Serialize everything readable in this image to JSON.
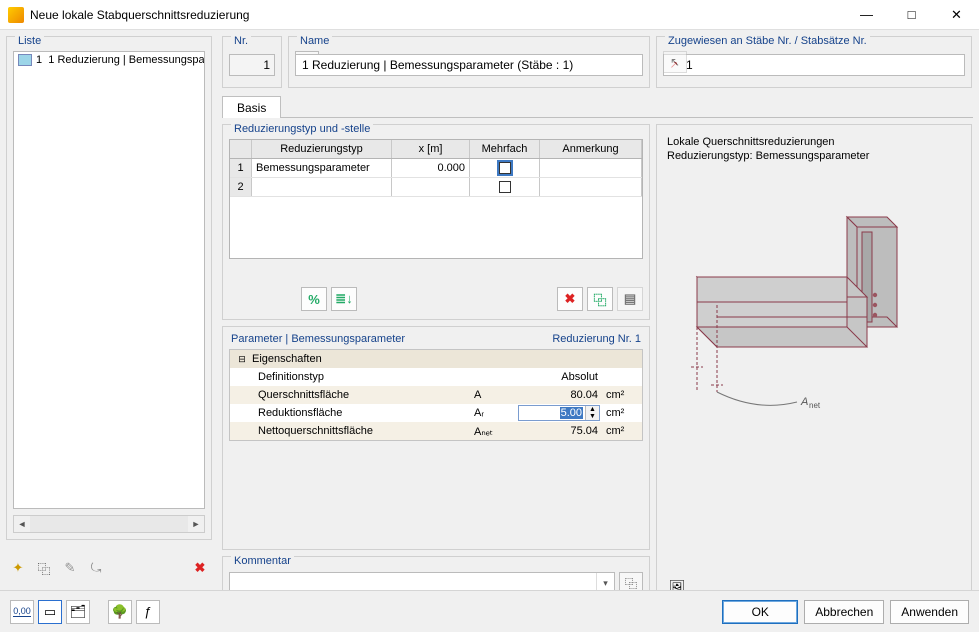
{
  "window": {
    "title": "Neue lokale Stabquerschnittsreduzierung"
  },
  "panels": {
    "liste": "Liste",
    "nr": "Nr.",
    "name": "Name",
    "assigned": "Zugewiesen an Stäbe Nr. / Stabsätze Nr.",
    "basis_tab": "Basis",
    "redtyp": "Reduzierungstyp und -stelle",
    "param": "Parameter | Bemessungsparameter",
    "rednr": "Reduzierung Nr. 1",
    "kommentar": "Kommentar"
  },
  "list": {
    "items": [
      {
        "id": "1",
        "num": "1",
        "label": "Reduzierung | Bemessungspa"
      }
    ]
  },
  "header": {
    "nr_value": "1",
    "name_value": "1 Reduzierung | Bemessungsparameter (Stäbe : 1)",
    "assigned_value": "1"
  },
  "grid": {
    "cols": {
      "typ": "Reduzierungstyp",
      "x": "x [m]",
      "mf": "Mehrfach",
      "an": "Anmerkung"
    },
    "rows": [
      {
        "n": "1",
        "typ": "Bemessungsparameter",
        "x": "0.000",
        "mf": false,
        "an": ""
      },
      {
        "n": "2",
        "typ": "",
        "x": "",
        "mf": null,
        "an": ""
      }
    ],
    "tb": {
      "pct": "%",
      "sort": "≣↓",
      "del": "✖",
      "copy": "⿻",
      "more": "▤"
    }
  },
  "param": {
    "cat": "Eigenschaften",
    "rows": [
      {
        "name": "Definitionstyp",
        "sym": "",
        "val": "Absolut",
        "unit": ""
      },
      {
        "name": "Querschnittsfläche",
        "sym": "A",
        "val": "80.04",
        "unit": "cm²"
      },
      {
        "name": "Reduktionsfläche",
        "sym": "Aᵣ",
        "val": "5.00",
        "unit": "cm²",
        "edit": true
      },
      {
        "name": "Nettoquerschnittsfläche",
        "sym": "Aₙₑₜ",
        "val": "75.04",
        "unit": "cm²"
      }
    ]
  },
  "preview": {
    "line1": "Lokale Querschnittsreduzierungen",
    "line2": "Reduzierungstyp: Bemessungsparameter"
  },
  "buttons": {
    "ok": "OK",
    "cancel": "Abbrechen",
    "apply": "Anwenden"
  }
}
